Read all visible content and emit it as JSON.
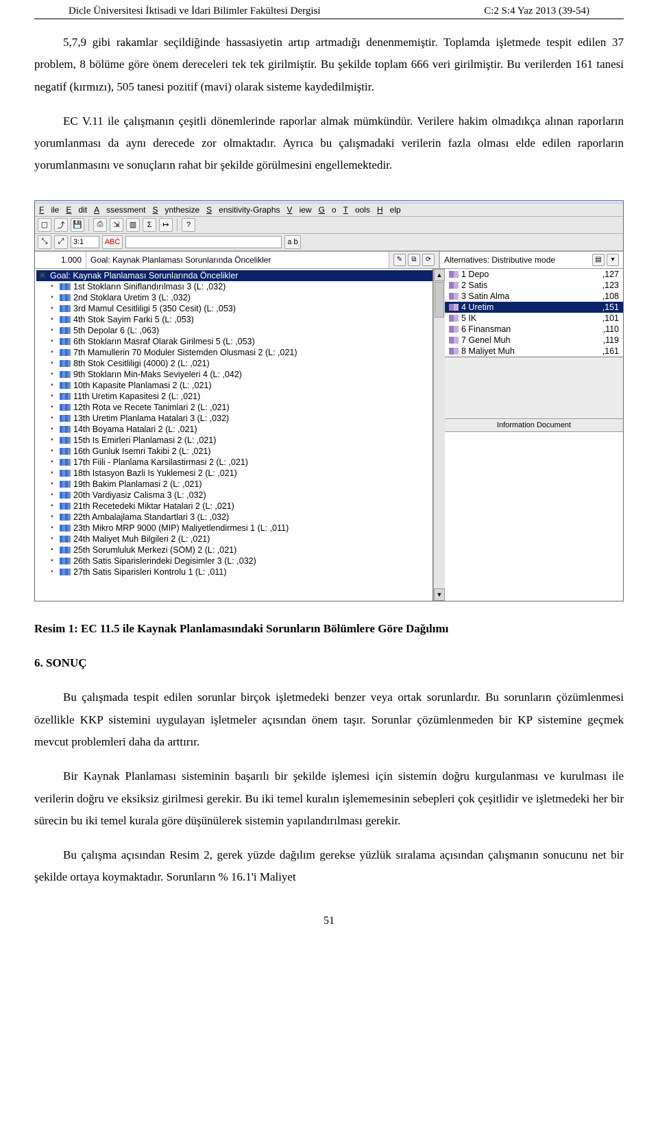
{
  "header": {
    "left": "Dicle Üniversitesi İktisadi ve İdari Bilimler Fakültesi Dergisi",
    "right": "C:2 S:4 Yaz 2013 (39-54)"
  },
  "paragraphs": {
    "p1": "5,7,9 gibi rakamlar seçildiğinde hassasiyetin artıp artmadığı denenmemiştir. Toplamda işletmede tespit edilen 37 problem, 8 bölüme göre önem dereceleri tek tek girilmiştir. Bu şekilde toplam 666 veri girilmiştir. Bu verilerden 161 tanesi negatif (kırmızı), 505 tanesi pozitif (mavi) olarak sisteme kaydedilmiştir.",
    "p2": "EC V.11 ile çalışmanın çeşitli dönemlerinde raporlar almak mümkündür. Verilere hakim olmadıkça alınan raporların yorumlanması da aynı derecede zor olmaktadır. Ayrıca bu çalışmadaki verilerin fazla olması elde edilen raporların yorumlanmasını ve sonuçların rahat bir şekilde görülmesini engellemektedir.",
    "caption": "Resim 1: EC 11.5 ile Kaynak Planlamasındaki Sorunların Bölümlere Göre Dağılımı",
    "section": "6. SONUÇ",
    "p3": "Bu çalışmada tespit edilen sorunlar birçok işletmedeki benzer veya ortak sorunlardır. Bu sorunların çözümlenmesi özellikle KKP sistemini uygulayan işletmeler açısından önem taşır. Sorunlar çözümlenmeden bir KP sistemine geçmek mevcut problemleri daha da arttırır.",
    "p4": "Bir Kaynak Planlaması sisteminin başarılı bir şekilde işlemesi için sistemin doğru kurgulanması ve kurulması ile verilerin doğru ve eksiksiz girilmesi gerekir. Bu iki temel kuralın işlememesinin sebepleri çok çeşitlidir ve işletmedeki her bir sürecin bu iki temel kurala göre düşünülerek sistemin yapılandırılması gerekir.",
    "p5": "Bu çalışma açısından Resim 2, gerek yüzde dağılım gerekse yüzlük sıralama açısından çalışmanın sonucunu net bir şekilde ortaya koymaktadır. Sorunların % 16.1'i Maliyet"
  },
  "page_number": "51",
  "app": {
    "menus": [
      "File",
      "Edit",
      "Assessment",
      "Synthesize",
      "Sensitivity-Graphs",
      "View",
      "Go",
      "Tools",
      "Help"
    ],
    "toolbar": {
      "ratio": "3:1",
      "abc_btn": "ABĊ",
      "ab": "a ḃ"
    },
    "goal": {
      "weight": "1.000",
      "text": "Goal: Kaynak Planlaması Sorunlarında Öncelikler"
    },
    "alt_header": "Alternatives: Distributive mode",
    "tree": {
      "root": "Goal: Kaynak Planlaması Sorunlarında Öncelikler",
      "items": [
        "1st Stokların Siniflandırılması 3 (L: ,032)",
        "2nd Stoklara Uretim 3 (L: ,032)",
        "3rd Mamul Cesitliligi 5 (350 Cesit) (L: ,053)",
        "4th Stok Sayim Farki 5 (L: ,053)",
        "5th Depolar 6 (L: ,063)",
        "6th Stokların Masraf Olarak Girilmesi 5 (L: ,053)",
        "7th Mamullerin 70 Moduler Sistemden Olusmasi 2 (L: ,021)",
        "8th Stok Cesitliligi (4000) 2 (L: ,021)",
        "9th Stokların Min-Maks Seviyeleri 4 (L: ,042)",
        "10th Kapasite Planlamasi 2 (L: ,021)",
        "11th Uretim Kapasitesi 2 (L: ,021)",
        "12th Rota ve Recete Tanimlari 2 (L: ,021)",
        "13th Uretim Planlama Hatalari 3 (L: ,032)",
        "14th Boyama Hatalari 2 (L: ,021)",
        "15th Is Emirleri Planlamasi 2 (L: ,021)",
        "16th Gunluk Isemri Takibi 2 (L: ,021)",
        "17th Fiili - Planlama Karsilastirmasi 2 (L: ,021)",
        "18th Istasyon Bazli Is Yuklemesi 2 (L: ,021)",
        "19th Bakim Planlamasi 2 (L: ,021)",
        "20th Vardiyasiz Calisma 3 (L: ,032)",
        "21th Recetedeki Miktar Hatalari 2 (L: ,021)",
        "22th Ambalajlama Standartlari 3 (L: ,032)",
        "23th Mikro MRP 9000 (MIP) Maliyetlendirmesi 1 (L: ,011)",
        "24th Maliyet Muh Bilgileri 2 (L: ,021)",
        "25th Sorumluluk Merkezi (SOM) 2 (L: ,021)",
        "26th Satis Siparislerindeki Degisimler 3 (L: ,032)",
        "27th Satis Siparisleri Kontrolu 1 (L: ,011)"
      ]
    },
    "alternatives": [
      {
        "name": "1 Depo",
        "val": ",127"
      },
      {
        "name": "2 Satis",
        "val": ",123"
      },
      {
        "name": "3 Satin Alma",
        "val": ",108"
      },
      {
        "name": "4 Uretim",
        "val": ",151"
      },
      {
        "name": "5 IK",
        "val": ",101"
      },
      {
        "name": "6 Finansman",
        "val": ",110"
      },
      {
        "name": "7 Genel Muh",
        "val": ",119"
      },
      {
        "name": "8 Maliyet Muh",
        "val": ",161"
      }
    ],
    "info_header": "Information Document"
  }
}
